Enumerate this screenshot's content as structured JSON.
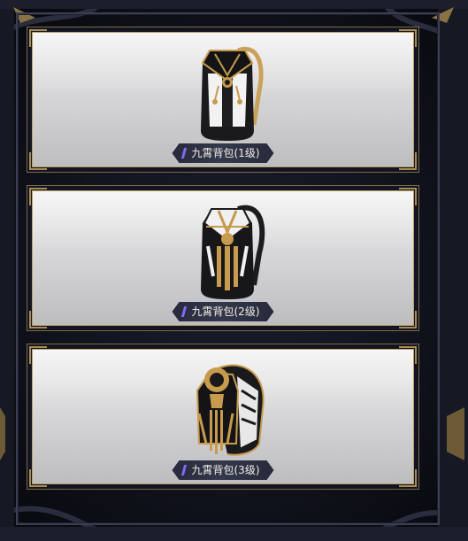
{
  "items": [
    {
      "name": "九霄背包(1级)",
      "tier": 1
    },
    {
      "name": "九霄背包(2级)",
      "tier": 2
    },
    {
      "name": "九霄背包(3级)",
      "tier": 3
    }
  ],
  "colors": {
    "frame_gold": "#b79e6a",
    "label_bg": "#2d3144",
    "label_accent": "#7f6cf0",
    "card_bg": "#dcdcde",
    "bag_black": "#161618",
    "bag_gold": "#c79a4d",
    "bag_white": "#f2f2f2"
  }
}
